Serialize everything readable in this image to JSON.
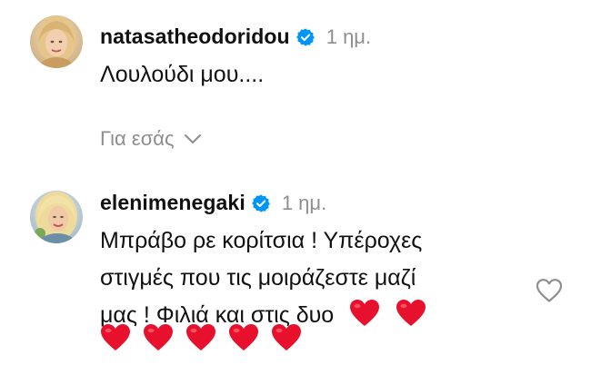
{
  "comments": [
    {
      "username": "natasatheodoridou",
      "verified": true,
      "time": "1 ημ.",
      "text": "Λουλούδι μου....",
      "avatar_icon": "avatar-blonde-woman"
    },
    {
      "username": "elenimenegaki",
      "verified": true,
      "time": "1 ημ.",
      "text_line1": "Μπράβο ρε κορίτσια ! Υπέροχες",
      "text_line2": "στιγμές που τις μοιράζεστε μαζί",
      "text_line3": "μας ! Φιλιά και στις δυο",
      "hearts_inline": 2,
      "hearts_next_line": 5,
      "avatar_icon": "avatar-blonde-woman-smiling"
    }
  ],
  "filter": {
    "label": "Για εσάς"
  },
  "colors": {
    "verified_blue": "#0095f6",
    "muted_text": "#8e8e8e",
    "heart_red": "#e8112d"
  }
}
